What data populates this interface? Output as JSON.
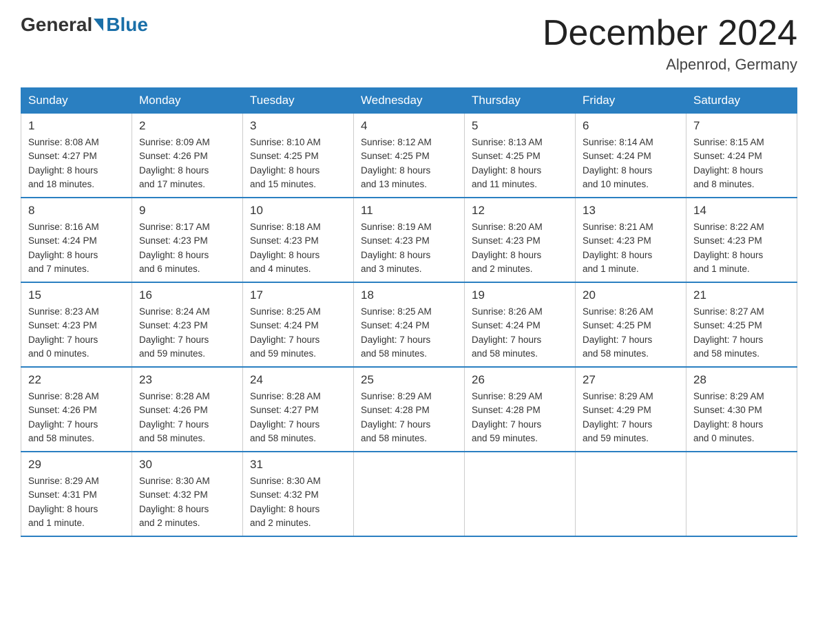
{
  "header": {
    "logo_general": "General",
    "logo_blue": "Blue",
    "month_title": "December 2024",
    "location": "Alpenrod, Germany"
  },
  "days_of_week": [
    "Sunday",
    "Monday",
    "Tuesday",
    "Wednesday",
    "Thursday",
    "Friday",
    "Saturday"
  ],
  "weeks": [
    [
      {
        "day": "1",
        "sunrise": "8:08 AM",
        "sunset": "4:27 PM",
        "daylight": "8 hours and 18 minutes."
      },
      {
        "day": "2",
        "sunrise": "8:09 AM",
        "sunset": "4:26 PM",
        "daylight": "8 hours and 17 minutes."
      },
      {
        "day": "3",
        "sunrise": "8:10 AM",
        "sunset": "4:25 PM",
        "daylight": "8 hours and 15 minutes."
      },
      {
        "day": "4",
        "sunrise": "8:12 AM",
        "sunset": "4:25 PM",
        "daylight": "8 hours and 13 minutes."
      },
      {
        "day": "5",
        "sunrise": "8:13 AM",
        "sunset": "4:25 PM",
        "daylight": "8 hours and 11 minutes."
      },
      {
        "day": "6",
        "sunrise": "8:14 AM",
        "sunset": "4:24 PM",
        "daylight": "8 hours and 10 minutes."
      },
      {
        "day": "7",
        "sunrise": "8:15 AM",
        "sunset": "4:24 PM",
        "daylight": "8 hours and 8 minutes."
      }
    ],
    [
      {
        "day": "8",
        "sunrise": "8:16 AM",
        "sunset": "4:24 PM",
        "daylight": "8 hours and 7 minutes."
      },
      {
        "day": "9",
        "sunrise": "8:17 AM",
        "sunset": "4:23 PM",
        "daylight": "8 hours and 6 minutes."
      },
      {
        "day": "10",
        "sunrise": "8:18 AM",
        "sunset": "4:23 PM",
        "daylight": "8 hours and 4 minutes."
      },
      {
        "day": "11",
        "sunrise": "8:19 AM",
        "sunset": "4:23 PM",
        "daylight": "8 hours and 3 minutes."
      },
      {
        "day": "12",
        "sunrise": "8:20 AM",
        "sunset": "4:23 PM",
        "daylight": "8 hours and 2 minutes."
      },
      {
        "day": "13",
        "sunrise": "8:21 AM",
        "sunset": "4:23 PM",
        "daylight": "8 hours and 1 minute."
      },
      {
        "day": "14",
        "sunrise": "8:22 AM",
        "sunset": "4:23 PM",
        "daylight": "8 hours and 1 minute."
      }
    ],
    [
      {
        "day": "15",
        "sunrise": "8:23 AM",
        "sunset": "4:23 PM",
        "daylight": "7 hours and 0 minutes."
      },
      {
        "day": "16",
        "sunrise": "8:24 AM",
        "sunset": "4:23 PM",
        "daylight": "7 hours and 59 minutes."
      },
      {
        "day": "17",
        "sunrise": "8:25 AM",
        "sunset": "4:24 PM",
        "daylight": "7 hours and 59 minutes."
      },
      {
        "day": "18",
        "sunrise": "8:25 AM",
        "sunset": "4:24 PM",
        "daylight": "7 hours and 58 minutes."
      },
      {
        "day": "19",
        "sunrise": "8:26 AM",
        "sunset": "4:24 PM",
        "daylight": "7 hours and 58 minutes."
      },
      {
        "day": "20",
        "sunrise": "8:26 AM",
        "sunset": "4:25 PM",
        "daylight": "7 hours and 58 minutes."
      },
      {
        "day": "21",
        "sunrise": "8:27 AM",
        "sunset": "4:25 PM",
        "daylight": "7 hours and 58 minutes."
      }
    ],
    [
      {
        "day": "22",
        "sunrise": "8:28 AM",
        "sunset": "4:26 PM",
        "daylight": "7 hours and 58 minutes."
      },
      {
        "day": "23",
        "sunrise": "8:28 AM",
        "sunset": "4:26 PM",
        "daylight": "7 hours and 58 minutes."
      },
      {
        "day": "24",
        "sunrise": "8:28 AM",
        "sunset": "4:27 PM",
        "daylight": "7 hours and 58 minutes."
      },
      {
        "day": "25",
        "sunrise": "8:29 AM",
        "sunset": "4:28 PM",
        "daylight": "7 hours and 58 minutes."
      },
      {
        "day": "26",
        "sunrise": "8:29 AM",
        "sunset": "4:28 PM",
        "daylight": "7 hours and 59 minutes."
      },
      {
        "day": "27",
        "sunrise": "8:29 AM",
        "sunset": "4:29 PM",
        "daylight": "7 hours and 59 minutes."
      },
      {
        "day": "28",
        "sunrise": "8:29 AM",
        "sunset": "4:30 PM",
        "daylight": "8 hours and 0 minutes."
      }
    ],
    [
      {
        "day": "29",
        "sunrise": "8:29 AM",
        "sunset": "4:31 PM",
        "daylight": "8 hours and 1 minute."
      },
      {
        "day": "30",
        "sunrise": "8:30 AM",
        "sunset": "4:32 PM",
        "daylight": "8 hours and 2 minutes."
      },
      {
        "day": "31",
        "sunrise": "8:30 AM",
        "sunset": "4:32 PM",
        "daylight": "8 hours and 2 minutes."
      },
      null,
      null,
      null,
      null
    ]
  ],
  "labels": {
    "sunrise_label": "Sunrise:",
    "sunset_label": "Sunset:",
    "daylight_label": "Daylight:"
  }
}
